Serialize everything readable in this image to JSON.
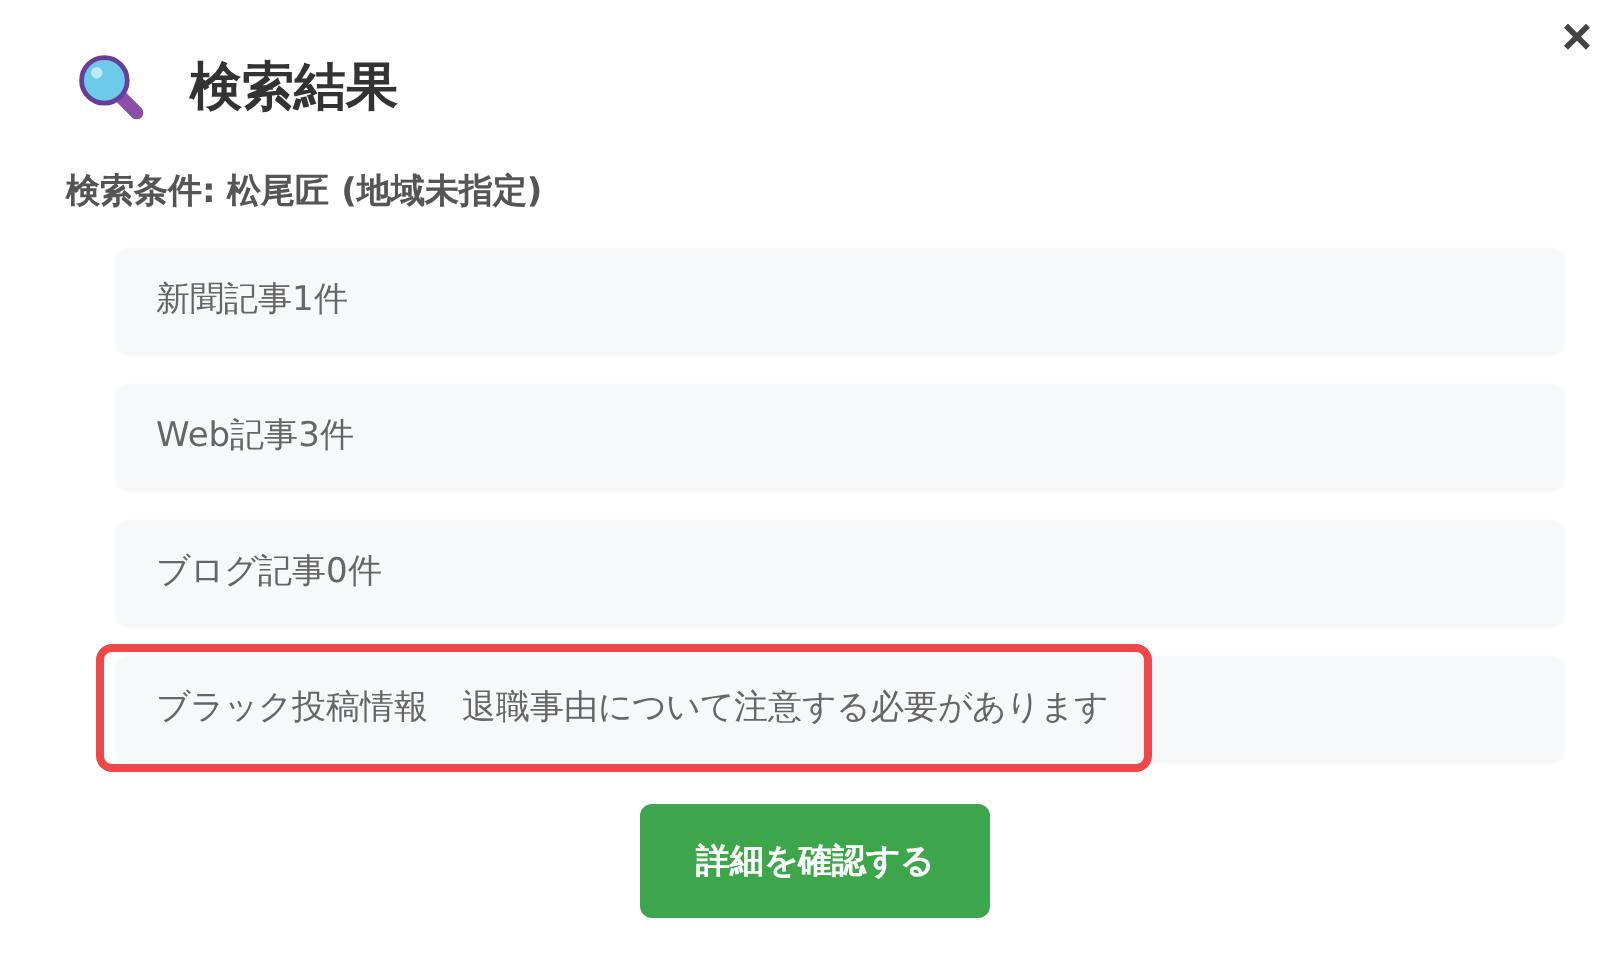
{
  "dialog": {
    "title": "検索結果",
    "close": "×"
  },
  "condition": "検索条件: 松尾匠 (地域未指定)",
  "results": [
    {
      "label": "新聞記事1件",
      "highlighted": false
    },
    {
      "label": "Web記事3件",
      "highlighted": false
    },
    {
      "label": "ブログ記事0件",
      "highlighted": false
    },
    {
      "label": "ブラック投稿情報　退職事由について注意する必要があります",
      "highlighted": true
    }
  ],
  "button": "詳細を確認する"
}
